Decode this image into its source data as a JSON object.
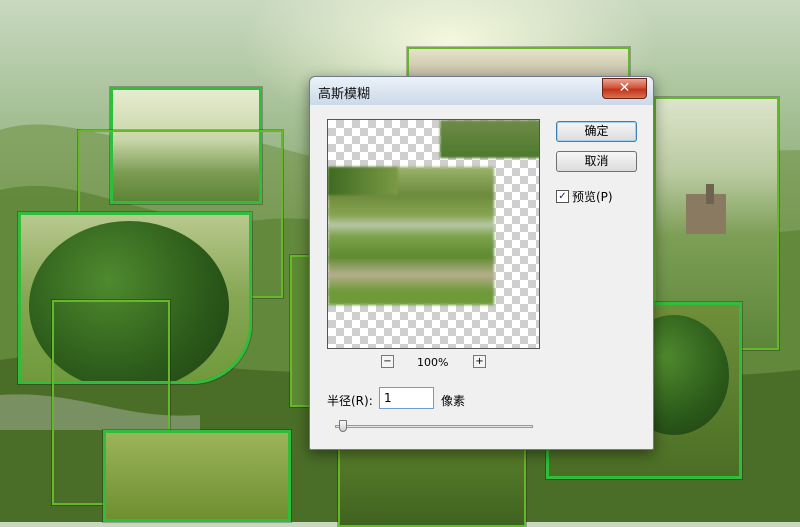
{
  "dialog": {
    "title": "高斯模糊",
    "close_glyph": "✕",
    "ok_label": "确定",
    "cancel_label": "取消",
    "preview_label": "预览(P)",
    "preview_checked": true,
    "check_glyph": "✓",
    "zoom_out": "−",
    "zoom_in": "+",
    "zoom_level": "100%",
    "radius_label": "半径(R):",
    "radius_value": "1",
    "radius_unit": "像素",
    "radius_slider_fraction": 0.01
  },
  "colors": {
    "tile_border": "#2fbd3b",
    "close_button": "#c2331a"
  }
}
